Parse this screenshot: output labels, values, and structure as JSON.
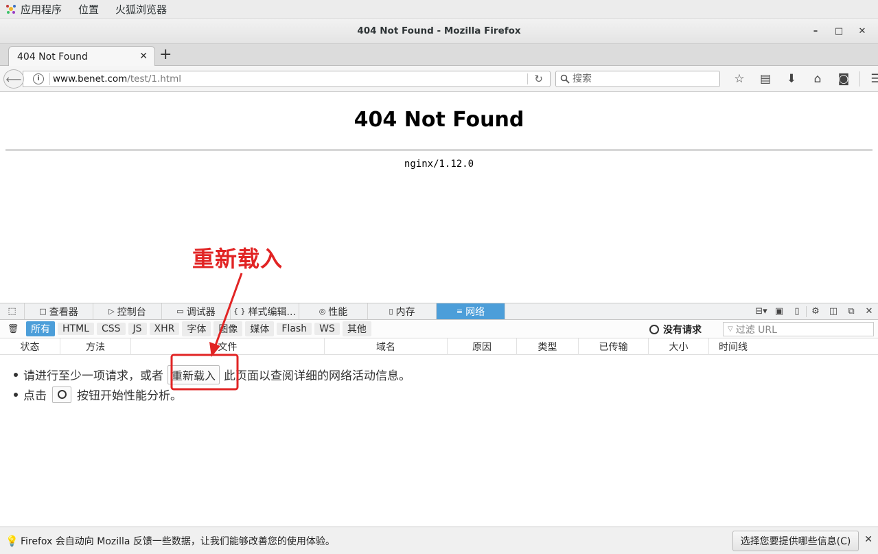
{
  "gnome": {
    "menus": [
      "应用程序",
      "位置",
      "火狐浏览器"
    ]
  },
  "window": {
    "title": "404 Not Found - Mozilla Firefox",
    "controls": [
      "–",
      "□",
      "✕"
    ]
  },
  "tab": {
    "label": "404 Not Found",
    "close": "✕",
    "new": "+"
  },
  "nav": {
    "url_host": "www.benet.com",
    "url_path": "/test/1.html",
    "search_placeholder": "搜索"
  },
  "page": {
    "heading": "404 Not Found",
    "server": "nginx/1.12.0"
  },
  "annotation": {
    "label": "重新载入",
    "color": "#e12424"
  },
  "devtools": {
    "tabs": [
      {
        "icon": "□",
        "label": "查看器"
      },
      {
        "icon": "▷",
        "label": "控制台"
      },
      {
        "icon": "▭",
        "label": "调试器"
      },
      {
        "icon": "{ }",
        "label": "样式编辑..."
      },
      {
        "icon": "◎",
        "label": "性能"
      },
      {
        "icon": "▯",
        "label": "内存"
      },
      {
        "icon": "≡",
        "label": "网络"
      }
    ],
    "active_tab": "网络",
    "filters": [
      "所有",
      "HTML",
      "CSS",
      "JS",
      "XHR",
      "字体",
      "图像",
      "媒体",
      "Flash",
      "WS",
      "其他"
    ],
    "active_filter": "所有",
    "no_requests": "没有请求",
    "filter_placeholder": "过滤 URL",
    "columns": [
      "状态",
      "方法",
      "文件",
      "域名",
      "原因",
      "类型",
      "已传输",
      "大小",
      "时间线"
    ],
    "empty_line1_a": "请进行至少一项请求，或者",
    "reload_button": "重新载入",
    "empty_line1_b": "此页面以查阅详细的网络活动信息。",
    "empty_line2_a": "点击",
    "empty_line2_b": "按钮开始性能分析。",
    "accent": "#4c9ed9"
  },
  "notification": {
    "text": "Firefox 会自动向 Mozilla 反馈一些数据，让我们能够改善您的使用体验。",
    "button": "选择您要提供哪些信息(C)"
  }
}
